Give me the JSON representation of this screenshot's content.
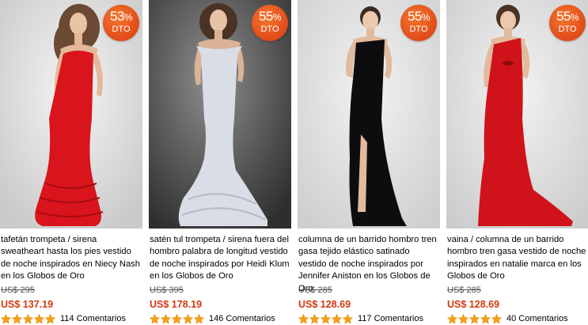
{
  "products": [
    {
      "discount_pct": "53",
      "discount_label": "DTO",
      "title": "tafetán trompeta / sirena sweatheart hasta los pies vestido de noche inspirados en Niecy Nash en los Globos de Oro",
      "old_price": "US$ 295",
      "price": "US$ 137.19",
      "rating": 5,
      "reviews": "114 Comentarios",
      "dress_color": "#d9141c"
    },
    {
      "discount_pct": "55",
      "discount_label": "DTO",
      "title": "satén tul trompeta / sirena fuera del hombro palabra de longitud vestido de noche inspirados por Heidi Klum en los Globos de Oro",
      "old_price": "US$ 395",
      "price": "US$ 178.19",
      "rating": 5,
      "reviews": "146 Comentarios",
      "dress_color": "#d9dde6"
    },
    {
      "discount_pct": "55",
      "discount_label": "DTO",
      "title": "columna de un barrido hombro tren gasa tejido elástico satinado vestido de noche inspirados por Jennifer Aniston en los Globos de Oro",
      "old_price": "US$ 285",
      "price": "US$ 128.69",
      "rating": 5,
      "reviews": "117 Comentarios",
      "dress_color": "#0d0d0f"
    },
    {
      "discount_pct": "55",
      "discount_label": "DTO",
      "title": "vaina / columna de un barrido hombro tren gasa vestido de noche inspirados en natalie marca en los Globos de Oro",
      "old_price": "US$ 285",
      "price": "US$ 128.69",
      "rating": 5,
      "reviews": "40 Comentarios",
      "dress_color": "#d0121a"
    }
  ]
}
